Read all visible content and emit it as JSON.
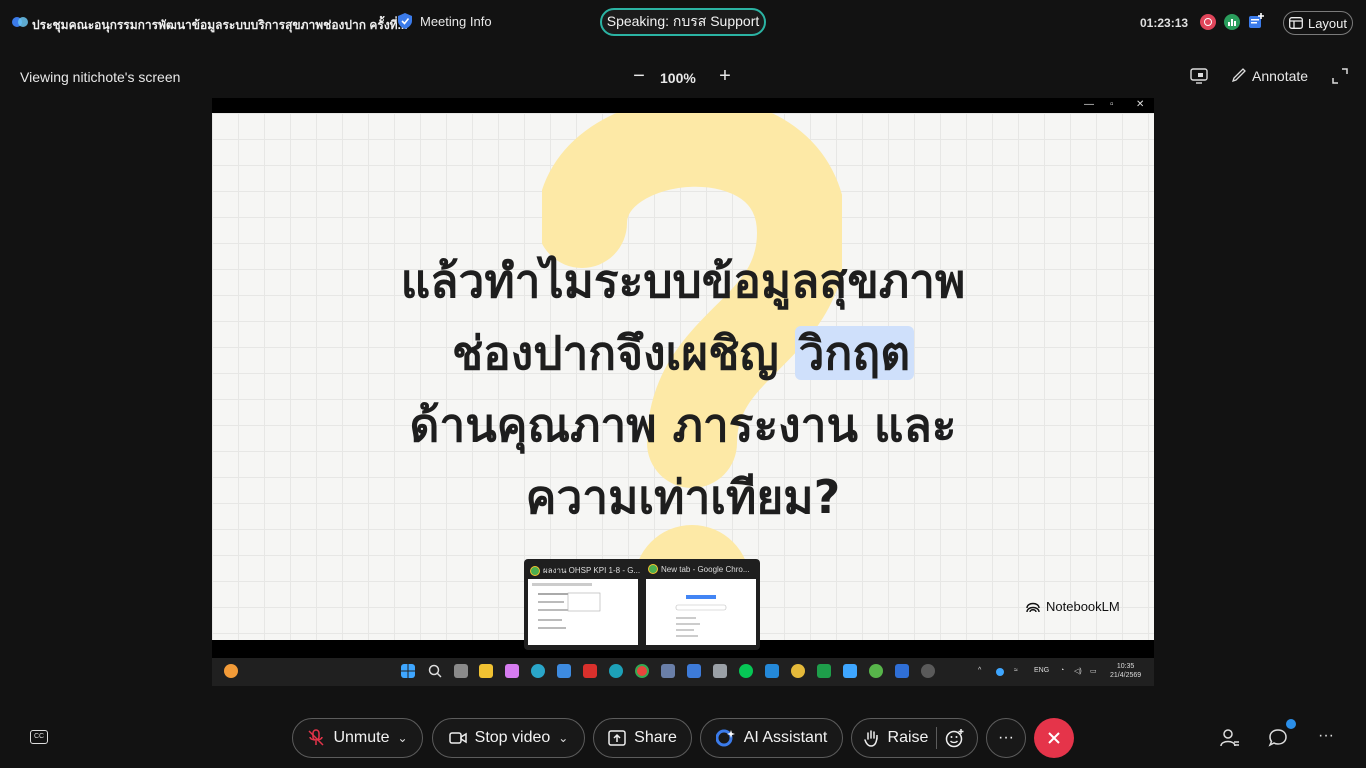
{
  "header": {
    "meeting_title": "ประชุมคณะอนุกรรมการพัฒนาข้อมูลระบบบริการสุขภาพช่องปาก ครั้งที่...",
    "meeting_info_label": "Meeting Info",
    "speaking_label": "Speaking: กบรส Support",
    "elapsed_time": "01:23:13",
    "layout_label": "Layout"
  },
  "share_bar": {
    "viewing_label": "Viewing nitichote's screen",
    "zoom_level": "100%",
    "annotate_label": "Annotate"
  },
  "slide": {
    "headline_line1": "แล้วทำไมระบบข้อมูลสุขภาพ",
    "headline_line2_a": "ช่องปากจึงเผชิญ ",
    "headline_line2_highlight": "วิกฤต",
    "headline_line3": "ด้านคุณภาพ ภาระงาน และ",
    "headline_line4": "ความเท่าเทียม?",
    "brand": "NotebookLM",
    "accent_color": "#fde9a6",
    "highlight_color": "#cfe0fb"
  },
  "thumbnails": [
    {
      "title": "ผลงาน OHSP KPI 1-8 - G..."
    },
    {
      "title": "New tab - Google Chro..."
    }
  ],
  "taskbar": {
    "lang": "ENG",
    "clock_time": "10:35",
    "clock_date": "21/4/2569"
  },
  "controls": {
    "unmute_label": "Unmute",
    "stop_video_label": "Stop video",
    "share_label": "Share",
    "ai_assistant_label": "AI Assistant",
    "raise_label": "Raise",
    "more_label": "···",
    "cc_label": "CC",
    "end_color": "#e5344a"
  }
}
